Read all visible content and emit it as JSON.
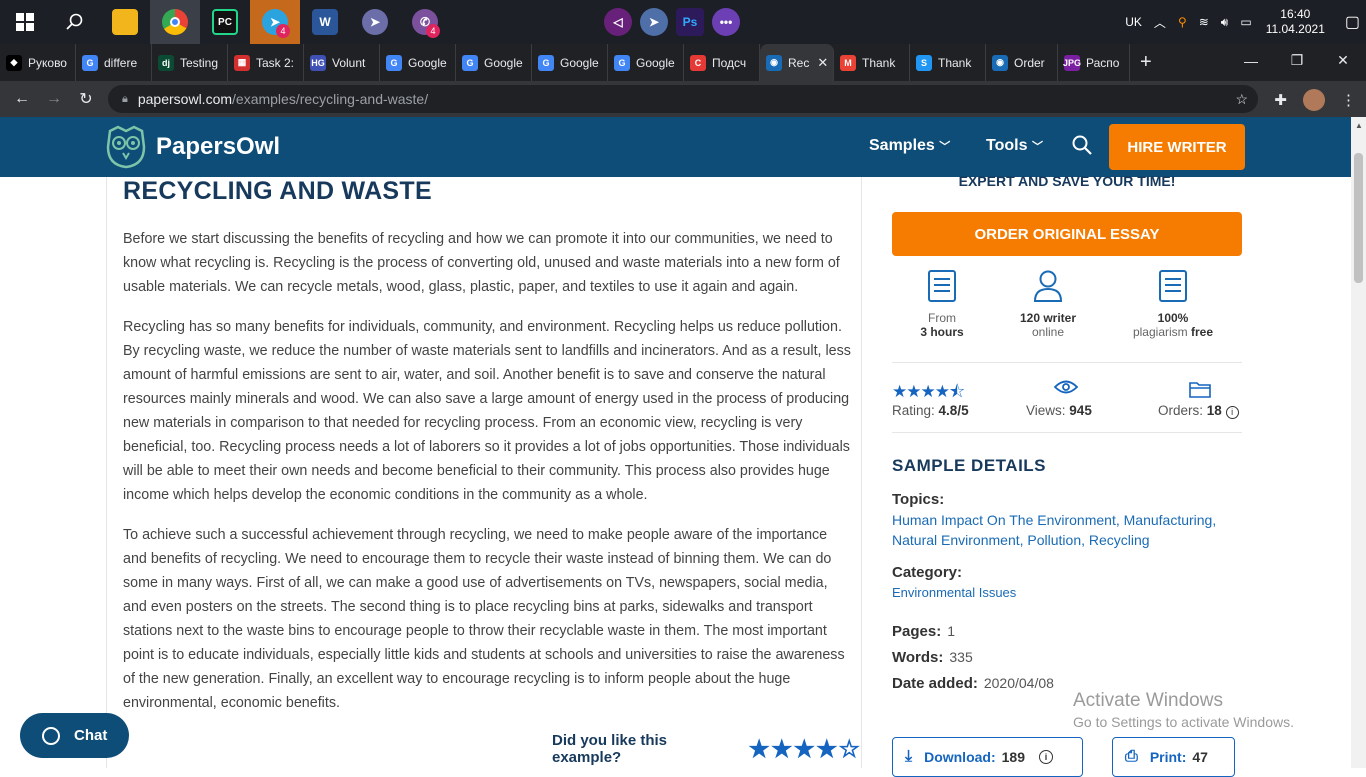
{
  "taskbar": {
    "search_icon": "search-icon",
    "badges": [
      "4",
      "4"
    ],
    "tray": {
      "lang": "UK",
      "time": "16:40",
      "date": "11.04.2021"
    }
  },
  "tabs": [
    {
      "label": "Руково",
      "color": "#000000",
      "glyph": "◆"
    },
    {
      "label": "differe",
      "color": "#4285f4",
      "glyph": "G"
    },
    {
      "label": "Testing",
      "color": "#0c4b33",
      "glyph": "dj"
    },
    {
      "label": "Task 2:",
      "color": "#d32f2f",
      "glyph": "▦"
    },
    {
      "label": "Volunt",
      "color": "#3f51b5",
      "glyph": "HG"
    },
    {
      "label": "Google",
      "color": "#4285f4",
      "glyph": "G"
    },
    {
      "label": "Google",
      "color": "#4285f4",
      "glyph": "G"
    },
    {
      "label": "Google",
      "color": "#4285f4",
      "glyph": "G"
    },
    {
      "label": "Google",
      "color": "#4285f4",
      "glyph": "G"
    },
    {
      "label": "Подсч",
      "color": "#e53935",
      "glyph": "C"
    },
    {
      "label": "Rec",
      "color": "#1a6bb5",
      "glyph": "◉",
      "active": true
    },
    {
      "label": "Thank",
      "color": "#ea4335",
      "glyph": "M"
    },
    {
      "label": "Thank",
      "color": "#2196f3",
      "glyph": "S"
    },
    {
      "label": "Order",
      "color": "#1a6bb5",
      "glyph": "◉"
    },
    {
      "label": "Распо",
      "color": "#7b1fa2",
      "glyph": "JPG"
    }
  ],
  "address": {
    "domain": "papersowl.com",
    "path": "/examples/recycling-and-waste/"
  },
  "site": {
    "brand": "PapersOwl",
    "menu_samples": "Samples",
    "menu_tools": "Tools",
    "hire": "HIRE WRITER"
  },
  "article": {
    "title": "RECYCLING AND WASTE",
    "p1": "Before we start discussing the benefits of recycling and how we can promote it into our communities, we need to know what recycling is. Recycling is the process of converting old, unused and waste materials into a new form of usable materials. We can recycle metals, wood, glass, plastic, paper, and textiles to use it again and again.",
    "p2": "Recycling has so many benefits for individuals, community, and environment. Recycling helps us reduce pollution. By recycling waste, we reduce the number of waste materials sent to landfills and incinerators. And as a result, less amount of harmful emissions are sent to air, water, and soil. Another benefit is to save and conserve the natural resources mainly minerals and wood. We can also save a large amount of energy used in the process of producing new materials in comparison to that needed for recycling process. From an economic view, recycling is very beneficial, too. Recycling process needs a lot of laborers so it provides a lot of jobs opportunities. Those individuals will be able to meet their own needs and become beneficial to their community. This process also provides huge income which helps develop the economic conditions in the community as a whole.",
    "p3": "To achieve such a successful achievement through recycling, we need to make people aware of the importance and benefits of recycling. We need to encourage them to recycle their waste instead of binning them. We can do some in many ways. First of all, we can make a good use of advertisements on TVs, newspapers, social media, and even posters on the streets. The second thing is to place recycling bins at parks, sidewalks and transport stations next to the waste bins to encourage people to throw their recyclable waste in them. The most important point is to educate individuals, especially little kids and students at schools and universities to raise the awareness of the new generation. Finally, an excellent way to encourage recycling is to inform people about the huge environmental, economic benefits.",
    "like_question": "Did you like this example?",
    "like_stars": "★★★★☆"
  },
  "sidebar": {
    "expert_line": "EXPERT AND SAVE YOUR TIME!",
    "order_button": "ORDER ORIGINAL ESSAY",
    "feature1": {
      "top": "From",
      "bottom": "3 hours"
    },
    "feature2": {
      "top": "120 writer",
      "bottom": "online"
    },
    "feature3": {
      "top": "100%",
      "bottom_a": "plagiarism",
      "bottom_b": "free"
    },
    "rating_stars": "★★★★⯪",
    "rating_label": "Rating:",
    "rating_value": "4.8/5",
    "views_label": "Views:",
    "views_value": "945",
    "orders_label": "Orders:",
    "orders_value": "18",
    "section_title": "SAMPLE DETAILS",
    "topics_label": "Topics:",
    "topics": [
      "Human Impact On The Environment",
      "Manufacturing",
      "Natural Environment",
      "Pollution",
      "Recycling"
    ],
    "category_label": "Category:",
    "category": "Environmental Issues",
    "pages_label": "Pages:",
    "pages": "1",
    "words_label": "Words:",
    "words": "335",
    "date_label": "Date added:",
    "date": "2020/04/08",
    "download_label": "Download:",
    "download_count": "189",
    "print_label": "Print:",
    "print_count": "47"
  },
  "watermark": {
    "line1": "Activate Windows",
    "line2": "Go to Settings to activate Windows."
  },
  "chat": {
    "label": "Chat"
  },
  "colors": {
    "header": "#0e4d78",
    "accent": "#f57c00",
    "link": "#1a6bb5",
    "star": "#1565c0"
  }
}
